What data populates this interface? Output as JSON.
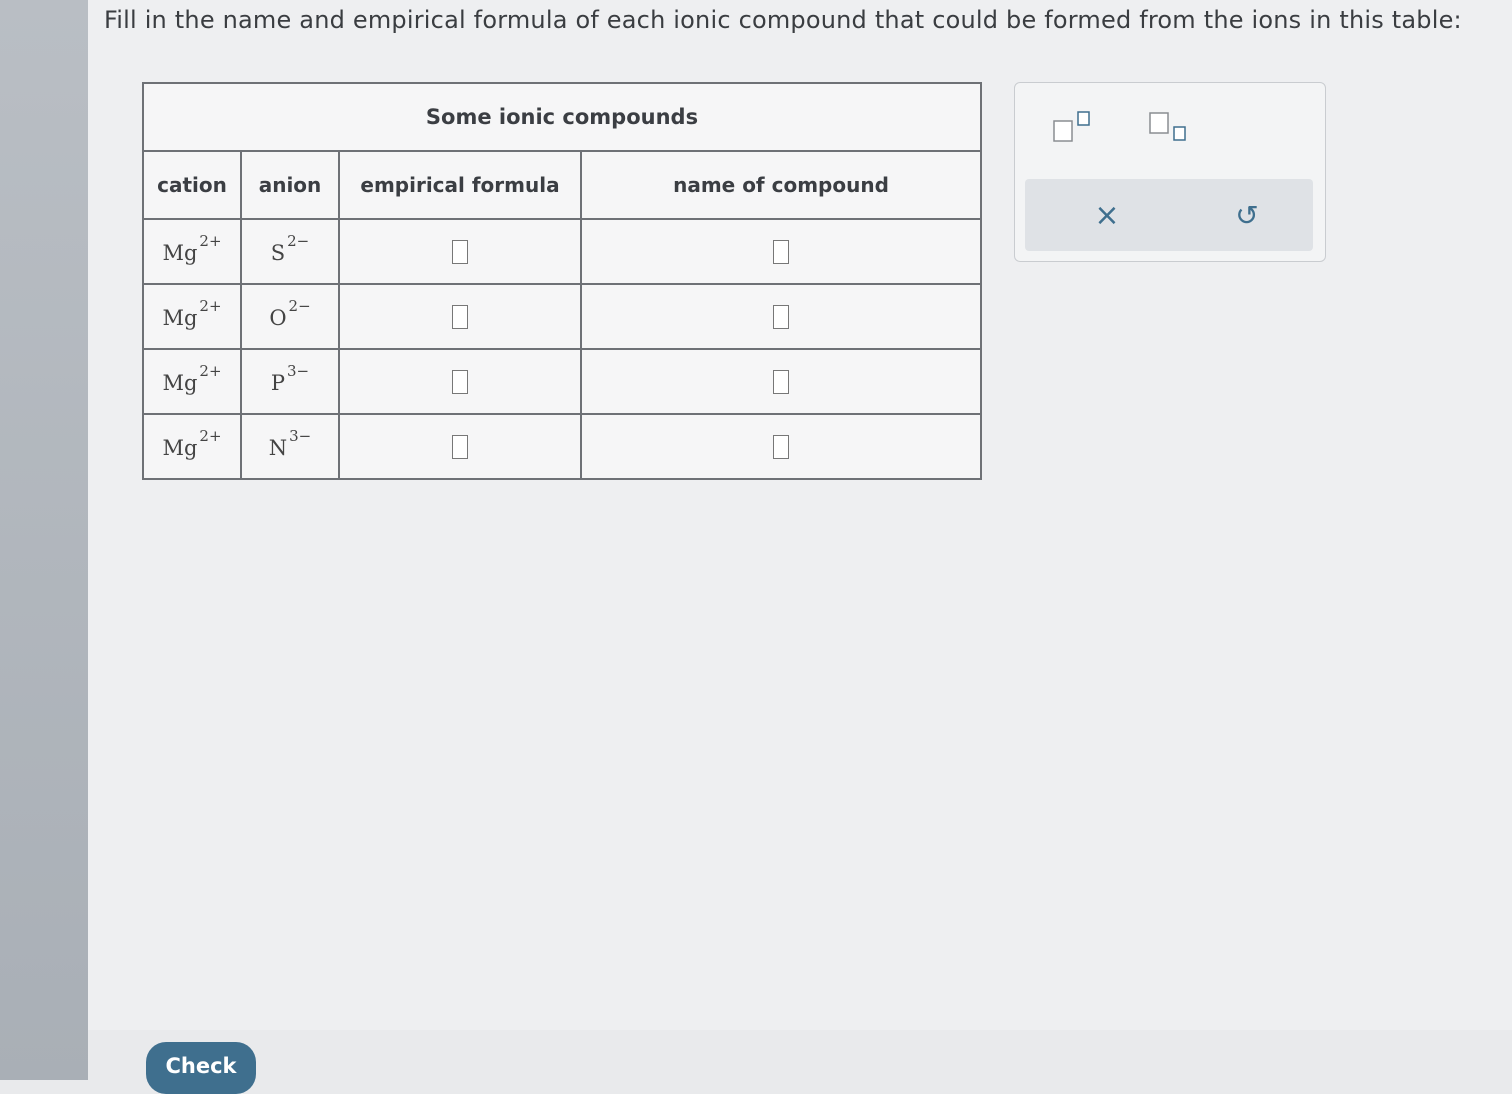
{
  "instruction": "Fill in the name and empirical formula of each ionic compound that could be formed from the ions in this table:",
  "table": {
    "caption": "Some ionic compounds",
    "headers": {
      "cation": "cation",
      "anion": "anion",
      "formula": "empirical formula",
      "name": "name of compound"
    },
    "rows": [
      {
        "cation": "Mg",
        "cation_charge": "2+",
        "anion": "S",
        "anion_charge": "2−",
        "formula": "",
        "name": ""
      },
      {
        "cation": "Mg",
        "cation_charge": "2+",
        "anion": "O",
        "anion_charge": "2−",
        "formula": "",
        "name": ""
      },
      {
        "cation": "Mg",
        "cation_charge": "2+",
        "anion": "P",
        "anion_charge": "3−",
        "formula": "",
        "name": ""
      },
      {
        "cation": "Mg",
        "cation_charge": "2+",
        "anion": "N",
        "anion_charge": "3−",
        "formula": "",
        "name": ""
      }
    ]
  },
  "toolbox": {
    "tools": [
      "superscript-tool",
      "subscript-tool"
    ],
    "actions": {
      "clear_symbol": "×",
      "undo_symbol": "↺"
    }
  },
  "check_button": "Check",
  "colors": {
    "check_button": "#3f6f8e",
    "border": "#6e7176"
  }
}
